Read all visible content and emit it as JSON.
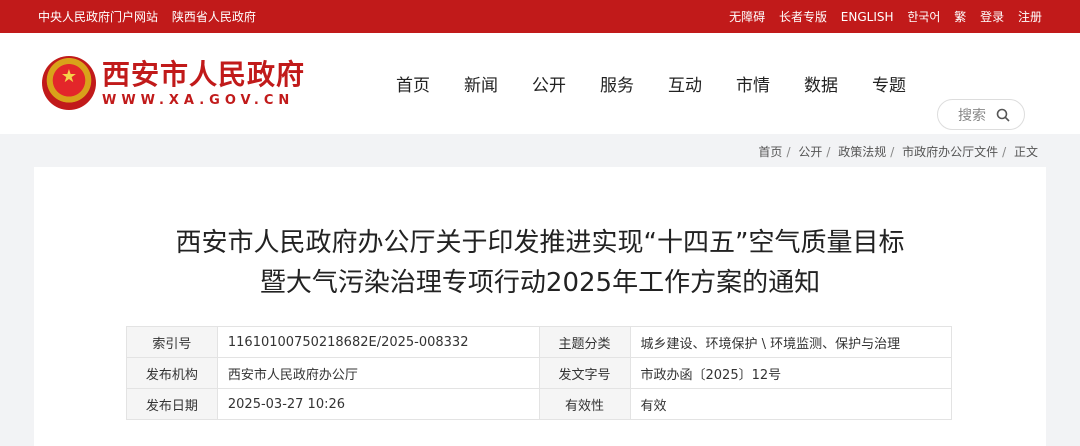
{
  "topbar": {
    "left_links": [
      "中央人民政府门户网站",
      "陕西省人民政府"
    ],
    "right_links": [
      "无障碍",
      "长者专版",
      "ENGLISH",
      "한국어",
      "繁",
      "登录",
      "注册"
    ]
  },
  "logo": {
    "name": "西安市人民政府",
    "url": "WWW.XA.GOV.CN"
  },
  "nav": {
    "items": [
      "首页",
      "新闻",
      "公开",
      "服务",
      "互动",
      "市情",
      "数据",
      "专题"
    ]
  },
  "search": {
    "placeholder": "搜索"
  },
  "breadcrumb": [
    "首页",
    "公开",
    "政策法规",
    "市政府办公厅文件",
    "正文"
  ],
  "article": {
    "title_line1": "西安市人民政府办公厅关于印发推进实现“十四五”空气质量目标",
    "title_line2": "暨大气污染治理专项行动2025年工作方案的通知"
  },
  "info": [
    {
      "l1": "索引号",
      "v1": "11610100750218682E/2025-008332",
      "l2": "主题分类",
      "v2": "城乡建设、环境保护 \\ 环境监测、保护与治理"
    },
    {
      "l1": "发布机构",
      "v1": "西安市人民政府办公厅",
      "l2": "发文字号",
      "v2": "市政办函〔2025〕12号"
    },
    {
      "l1": "发布日期",
      "v1": "2025-03-27 10:26",
      "l2": "有效性",
      "v2": "有效"
    }
  ],
  "colors": {
    "brand_red": "#c11a1a"
  }
}
